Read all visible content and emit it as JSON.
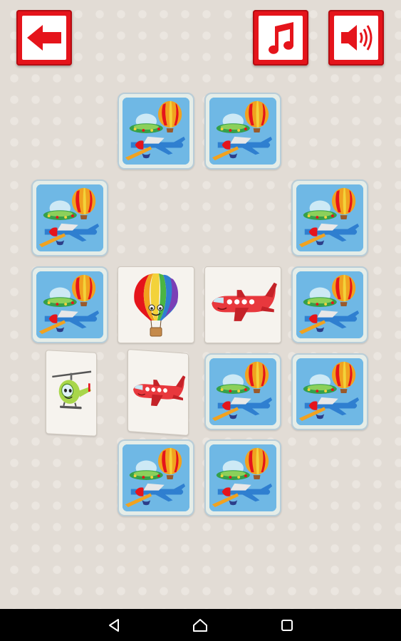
{
  "toolbar": {
    "back_icon": "arrow-left-icon",
    "music_icon": "music-note-icon",
    "sound_icon": "speaker-icon",
    "accent_color": "#e5141b"
  },
  "board": {
    "card_back_image": "ufo-balloon-airplane",
    "cards": [
      {
        "state": "face-down"
      },
      {
        "state": "face-down"
      },
      {
        "state": "face-down"
      },
      {
        "state": "face-down"
      },
      {
        "state": "face-down"
      },
      {
        "state": "face-up",
        "image": "hot-air-balloon"
      },
      {
        "state": "face-up",
        "image": "airplane"
      },
      {
        "state": "face-down"
      },
      {
        "state": "flipping",
        "image": "helicopter"
      },
      {
        "state": "flipping",
        "image": "airplane"
      },
      {
        "state": "face-down"
      },
      {
        "state": "face-down"
      },
      {
        "state": "face-down"
      },
      {
        "state": "face-down"
      }
    ]
  },
  "navbar": {
    "back_icon": "nav-back-icon",
    "home_icon": "nav-home-icon",
    "recents_icon": "nav-recents-icon"
  }
}
